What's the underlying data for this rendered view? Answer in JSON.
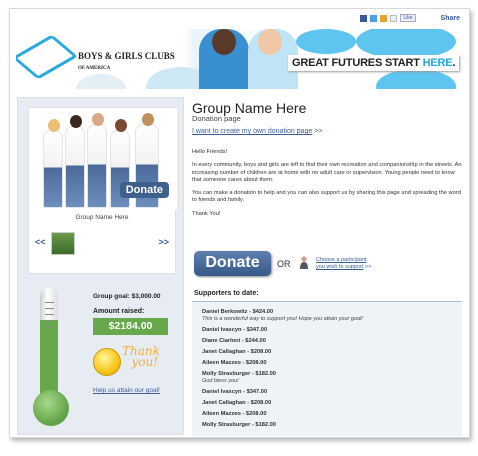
{
  "share": {
    "icons": [
      "facebook-icon",
      "twitter-icon",
      "myspace-icon",
      "email-icon"
    ],
    "like_label": "Like",
    "share_label": "Share"
  },
  "banner": {
    "org_name": "BOYS & GIRLS CLUBS",
    "org_sub": "OF AMERICA",
    "slogan_main": "GREAT FUTURES START ",
    "slogan_accent": "HERE",
    "slogan_end": "."
  },
  "gallery": {
    "donate_label": "Donate",
    "caption": "Group Name Here",
    "prev": "<<",
    "next": ">>"
  },
  "progress": {
    "goal_label": "Group goal: $3,000.00",
    "raised_label": "Amount  raised:",
    "raised_value": "$2184.00",
    "goal": 3000,
    "raised": 2184,
    "thanks": "Thank you!",
    "help_link": "Help us attain our goal!",
    "fill_color": "#66a84b"
  },
  "header": {
    "title": "Group Name Here",
    "subtitle": "Donation page",
    "create_link": "I want to create my own donation page",
    "create_suffix": " >>"
  },
  "message": [
    "Hello Friends!",
    "In every community, boys and girls are left to find their own recreation and companionship in the streets. An increasing number of children are at home with no adult care or supervision. Young people need to know that someone cares about them.",
    "You can make a donation to help and you can also support us by sharing this page and spreading the word to friends and family.",
    "Thank You!"
  ],
  "actions": {
    "donate_label": "Donate",
    "or_label": "OR",
    "choose_line1": "Choose a participant",
    "choose_line2": "you wish to support",
    "choose_suffix": " >>"
  },
  "supporters": {
    "title": "Supporters to date:",
    "items": [
      {
        "name": "Daniel Berkowitz - $424.00",
        "message": "This is a wonderful way to support you! Hope you attain your goal!"
      },
      {
        "name": "Daniel Ivascyn - $347.00",
        "message": ""
      },
      {
        "name": "Diane Ciarloni - $244.00",
        "message": ""
      },
      {
        "name": "Janet Callaghan - $208.00",
        "message": ""
      },
      {
        "name": "Aileen Mazzeo - $208.00",
        "message": ""
      },
      {
        "name": "Molly Strasburger - $182.00",
        "message": "God bless you!"
      },
      {
        "name": "Daniel Ivascyn - $347.00",
        "message": ""
      },
      {
        "name": "Janet Callaghan - $208.00",
        "message": ""
      },
      {
        "name": "Aileen Mazzeo - $208.00",
        "message": ""
      },
      {
        "name": "Molly Strasburger - $182.00",
        "message": ""
      }
    ]
  }
}
